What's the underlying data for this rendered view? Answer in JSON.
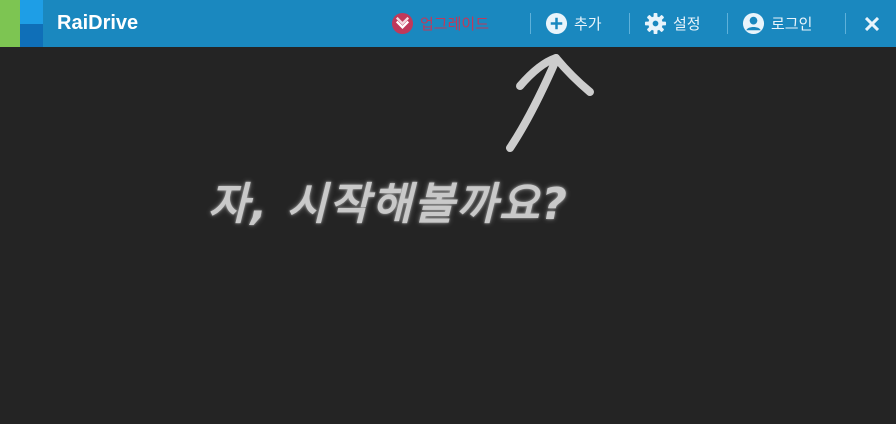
{
  "app": {
    "title": "RaiDrive"
  },
  "toolbar": {
    "upgrade_label": "업그레이드",
    "add_label": "추가",
    "settings_label": "설정",
    "login_label": "로그인",
    "close_icon": "close-icon"
  },
  "main": {
    "prompt_text": "자, 시작해볼까요?"
  },
  "colors": {
    "titlebar": "#1a88bf",
    "background": "#242424",
    "upgrade": "#c0395a",
    "logo_green": "#7dc552",
    "logo_blue": "#1e9ee6"
  }
}
